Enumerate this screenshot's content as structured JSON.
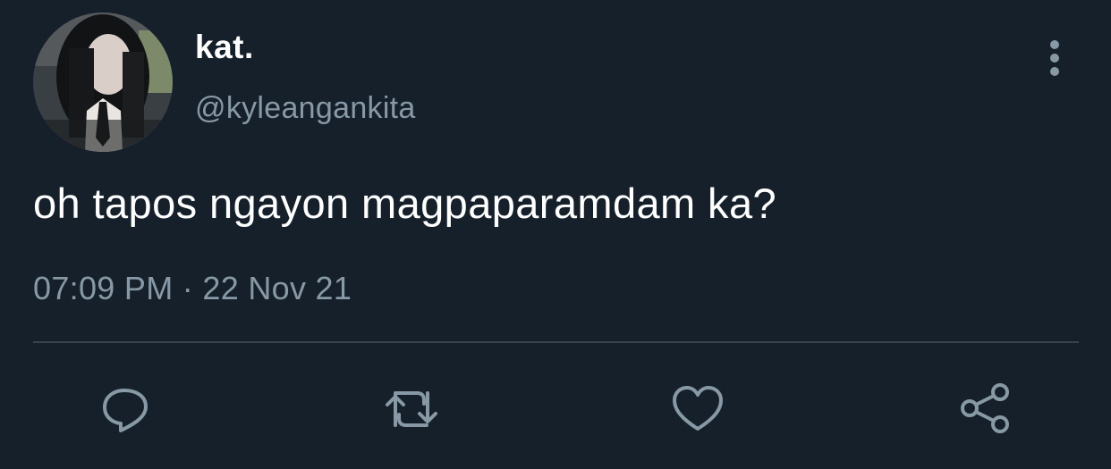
{
  "tweet": {
    "author": {
      "display_name": "kat.",
      "handle": "@kyleangankita"
    },
    "text": "oh tapos ngayon magpaparamdam ka?",
    "timestamp": "07:09 PM · 22 Nov 21"
  },
  "actions": [
    {
      "icon": "reply-icon"
    },
    {
      "icon": "retweet-icon"
    },
    {
      "icon": "like-icon"
    },
    {
      "icon": "share-icon"
    }
  ],
  "colors": {
    "background": "#15202b",
    "primary_text": "#ffffff",
    "secondary_text": "#8899a6",
    "divider": "#38444d"
  }
}
